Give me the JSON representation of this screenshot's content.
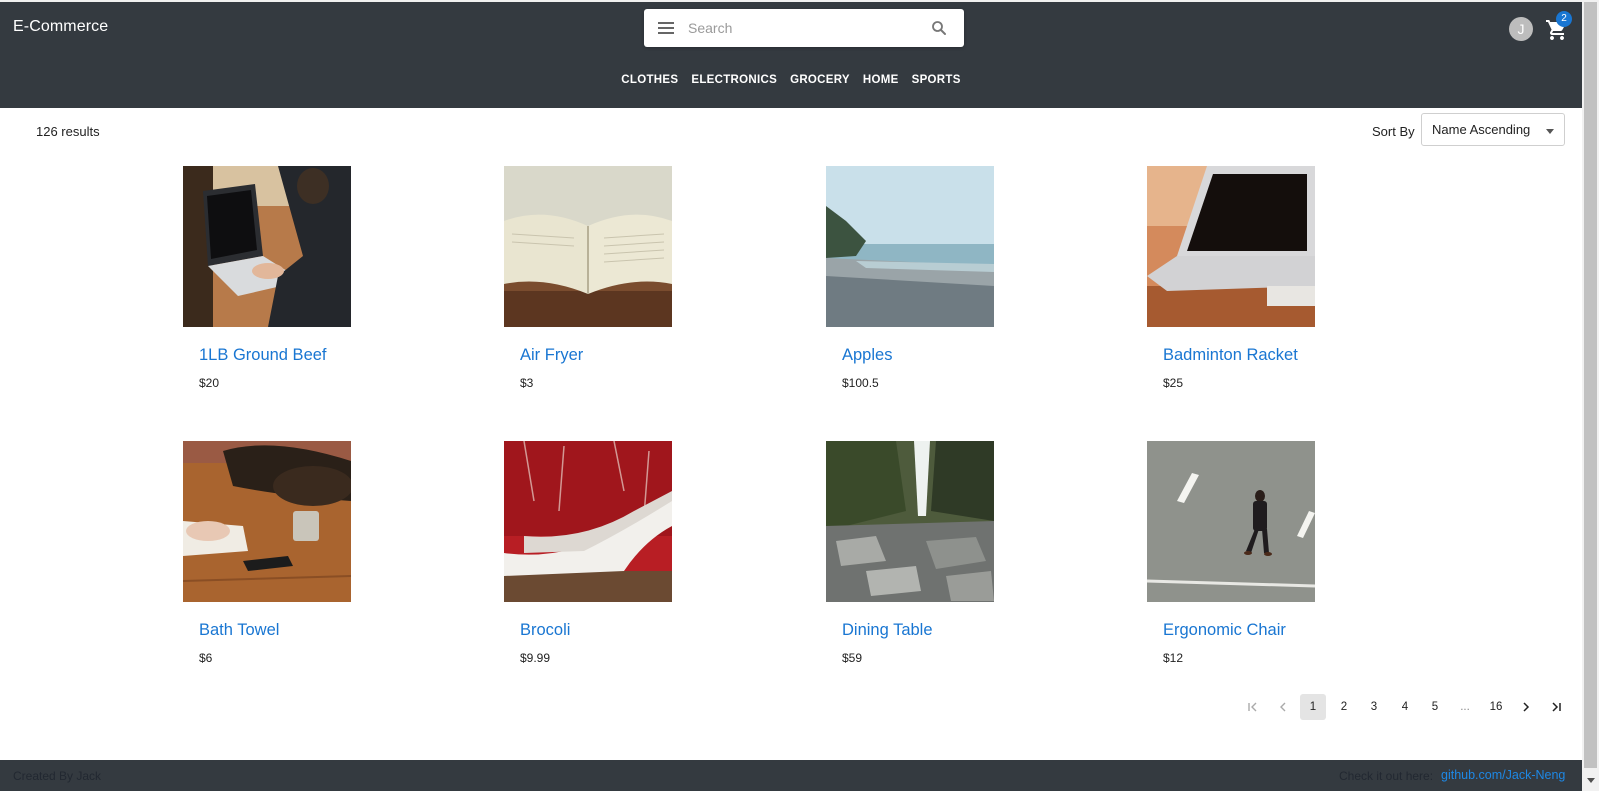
{
  "header": {
    "brand": "E-Commerce",
    "search_placeholder": "Search",
    "avatar_initial": "J",
    "cart_count": "2"
  },
  "nav": {
    "items": [
      "CLOTHES",
      "ELECTRONICS",
      "GROCERY",
      "HOME",
      "SPORTS"
    ]
  },
  "toolbar": {
    "result_count": "126 results",
    "sort_label": "Sort By",
    "sort_value": "Name Ascending"
  },
  "products": [
    {
      "name": "1LB Ground Beef",
      "price": "$20",
      "image": "laptop-on-desk"
    },
    {
      "name": "Air Fryer",
      "price": "$3",
      "image": "open-book"
    },
    {
      "name": "Apples",
      "price": "$100.5",
      "image": "beach-shore"
    },
    {
      "name": "Badminton Racket",
      "price": "$25",
      "image": "laptop-on-table"
    },
    {
      "name": "Bath Towel",
      "price": "$6",
      "image": "desk-with-notebook"
    },
    {
      "name": "Brocoli",
      "price": "$9.99",
      "image": "white-shoes"
    },
    {
      "name": "Dining Table",
      "price": "$59",
      "image": "waterfall-rocks"
    },
    {
      "name": "Ergonomic Chair",
      "price": "$12",
      "image": "man-on-road"
    }
  ],
  "pagination": {
    "pages": [
      "1",
      "2",
      "3",
      "4",
      "5",
      "...",
      "16"
    ],
    "current": "1"
  },
  "footer": {
    "credit": "Created By Jack",
    "check_text": "Check it out here:",
    "link_text": "github.com/Jack-Neng"
  },
  "colors": {
    "header_bg": "#343a40",
    "link": "#1976d2",
    "badge": "#1976d2"
  }
}
